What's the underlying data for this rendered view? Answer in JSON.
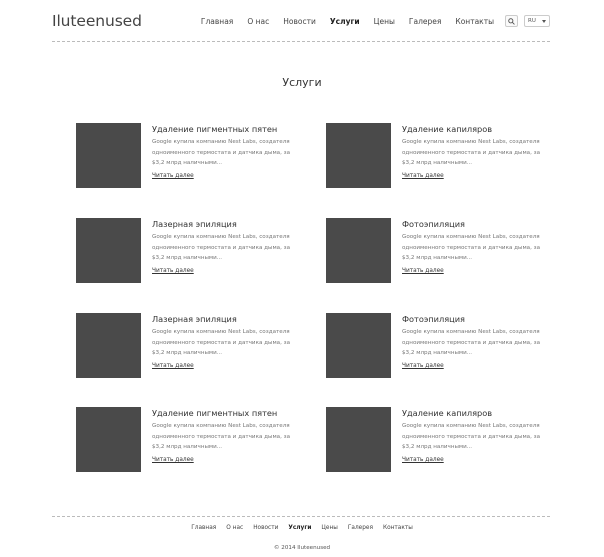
{
  "header": {
    "logo": "Iluteenused",
    "nav": [
      "Главная",
      "О нас",
      "Новости",
      "Услуги",
      "Цены",
      "Галерея",
      "Контакты"
    ],
    "active_nav": "Услуги",
    "search_icon": "search-icon",
    "language": "RU"
  },
  "main": {
    "title": "Услуги",
    "services": [
      {
        "title": "Удаление пигментных пятен",
        "desc": "Google купила компанию Nest Labs, создателя одноименного термостата и датчика дыма, за $3,2 млрд наличными...",
        "link": "Читать далее"
      },
      {
        "title": "Удаление капиляров",
        "desc": "Google купила компанию Nest Labs, создателя одноименного термостата и датчика дыма, за $3,2 млрд наличными...",
        "link": "Читать далее"
      },
      {
        "title": "Лазерная эпиляция",
        "desc": "Google купила компанию Nest Labs, создателя одноименного термостата и датчика дыма, за $3,2 млрд наличными...",
        "link": "Читать далее"
      },
      {
        "title": "Фотоэпиляция",
        "desc": "Google купила компанию Nest Labs, создателя одноименного термостата и датчика дыма, за $3,2 млрд наличными...",
        "link": "Читать далее"
      },
      {
        "title": "Лазерная эпиляция",
        "desc": "Google купила компанию Nest Labs, создателя одноименного термостата и датчика дыма, за $3,2 млрд наличными...",
        "link": "Читать далее"
      },
      {
        "title": "Фотоэпиляция",
        "desc": "Google купила компанию Nest Labs, создателя одноименного термостата и датчика дыма, за $3,2 млрд наличными...",
        "link": "Читать далее"
      },
      {
        "title": "Удаление пигментных пятен",
        "desc": "Google купила компанию Nest Labs, создателя одноименного термостата и датчика дыма, за $3,2 млрд наличными...",
        "link": "Читать далее"
      },
      {
        "title": "Удаление капиляров",
        "desc": "Google купила компанию Nest Labs, создателя одноименного термостата и датчика дыма, за $3,2 млрд наличными...",
        "link": "Читать далее"
      }
    ]
  },
  "footer": {
    "nav": [
      "Главная",
      "О нас",
      "Новости",
      "Услуги",
      "Цены",
      "Галерея",
      "Контакты"
    ],
    "active_nav": "Услуги",
    "copyright": "© 2014 Iluteenused"
  },
  "colors": {
    "thumb": "#4a4a4a",
    "divider": "#bbbbbb"
  }
}
